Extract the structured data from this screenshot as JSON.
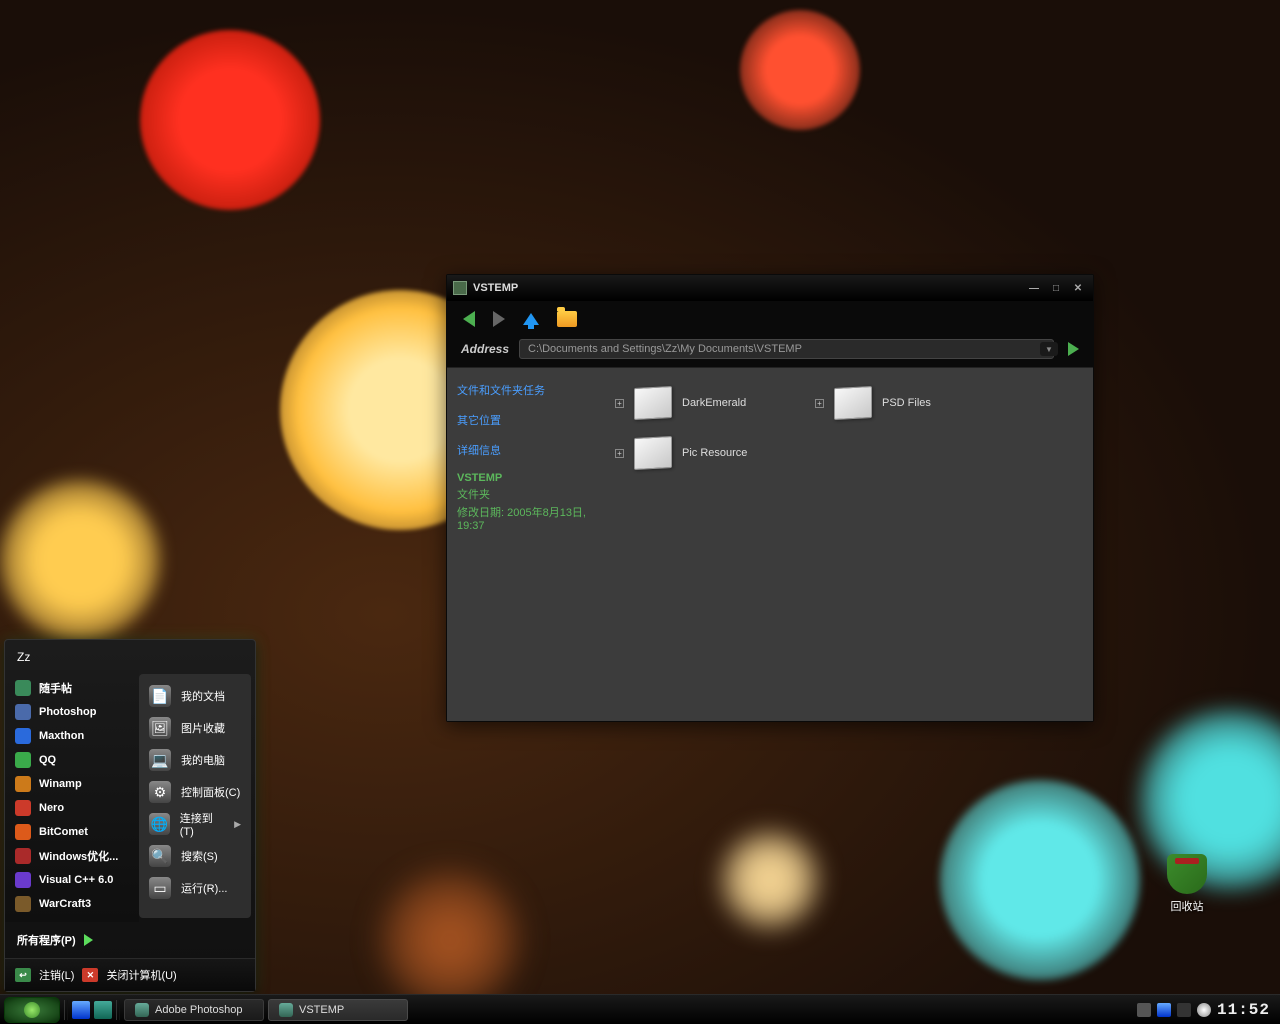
{
  "desktop": {
    "recycle_bin_label": "回收站"
  },
  "explorer": {
    "title": "VSTEMP",
    "address_label": "Address",
    "address_path": "C:\\Documents and Settings\\Zz\\My Documents\\VSTEMP",
    "sidebar": {
      "tasks_header": "文件和文件夹任务",
      "other_places_header": "其它位置",
      "details_header": "详细信息",
      "details_title": "VSTEMP",
      "details_type": "文件夹",
      "details_modified": "修改日期: 2005年8月13日, 19:37"
    },
    "items": [
      {
        "name": "DarkEmerald"
      },
      {
        "name": "PSD Files"
      },
      {
        "name": "Pic Resource"
      }
    ]
  },
  "start_menu": {
    "username": "Zz",
    "pinned": [
      {
        "label": "随手帖",
        "color": "#3a8a5a"
      },
      {
        "label": "Photoshop",
        "color": "#4a6aaa"
      },
      {
        "label": "Maxthon",
        "color": "#2a6adc"
      },
      {
        "label": "QQ",
        "color": "#3aaa4a"
      },
      {
        "label": "Winamp",
        "color": "#cc7a1a"
      },
      {
        "label": "Nero",
        "color": "#cc3a2a"
      },
      {
        "label": "BitComet",
        "color": "#dd5a1a"
      },
      {
        "label": "Windows优化...",
        "color": "#aa2a2a"
      },
      {
        "label": "Visual C++ 6.0",
        "color": "#6a3acc"
      },
      {
        "label": "WarCraft3",
        "color": "#7a5a2a"
      }
    ],
    "all_programs": "所有程序(P)",
    "right_items": [
      {
        "label": "我的文档",
        "icon": "📄",
        "arrow": false
      },
      {
        "label": "图片收藏",
        "icon": "🖼",
        "arrow": false
      },
      {
        "label": "我的电脑",
        "icon": "💻",
        "arrow": false
      },
      {
        "label": "控制面板(C)",
        "icon": "⚙",
        "arrow": false
      },
      {
        "label": "连接到(T)",
        "icon": "🌐",
        "arrow": true
      },
      {
        "label": "搜索(S)",
        "icon": "🔍",
        "arrow": false
      },
      {
        "label": "运行(R)...",
        "icon": "▭",
        "arrow": false
      }
    ],
    "logoff": "注销(L)",
    "shutdown": "关闭计算机(U)"
  },
  "taskbar": {
    "tasks": [
      {
        "label": "Adobe Photoshop",
        "active": false
      },
      {
        "label": "VSTEMP",
        "active": true
      }
    ],
    "clock": "11:52"
  }
}
